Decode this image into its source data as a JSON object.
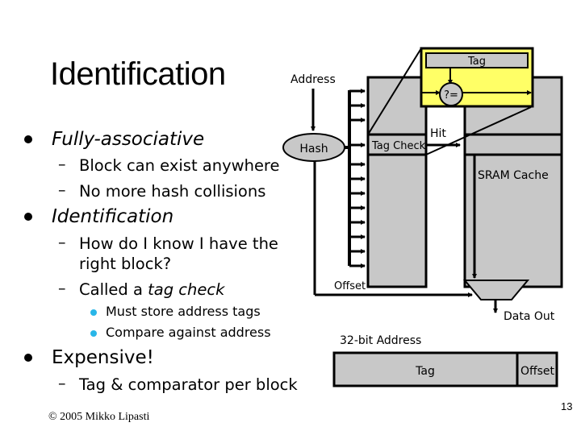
{
  "slide": {
    "title": "Identification",
    "bullets": [
      {
        "text": "Fully-associative",
        "italic": true,
        "sub": [
          {
            "text": "Block can exist anywhere"
          },
          {
            "text": "No more hash collisions"
          }
        ]
      },
      {
        "text": "Identification",
        "italic": true,
        "sub": [
          {
            "line1": "How do I know I have the",
            "line2": "right block?"
          },
          {
            "prefix": "Called a ",
            "italic_part": "tag check",
            "sub": [
              "Must store address tags",
              "Compare against address"
            ]
          }
        ]
      },
      {
        "text": "Expensive!",
        "italic": false,
        "sub": [
          {
            "text": "Tag & comparator per block"
          }
        ]
      }
    ],
    "footer": "© 2005 Mikko Lipasti",
    "page_number": "13"
  },
  "diagram": {
    "address_label": "Address",
    "hash_label": "Hash",
    "tag_check_label": "Tag Check",
    "hit_label": "Hit",
    "sram_label": "SRAM Cache",
    "offset_label": "Offset",
    "data_out_label": "Data Out",
    "zoom_tag_label": "Tag",
    "comparator_label": "?=",
    "address_format_title": "32-bit Address",
    "address_fields": [
      "Tag",
      "Offset"
    ],
    "colors": {
      "array_fill": "#c8c8c8",
      "zoom_fill": "#ffff66",
      "bullet_sub": "#29b6e8"
    }
  }
}
